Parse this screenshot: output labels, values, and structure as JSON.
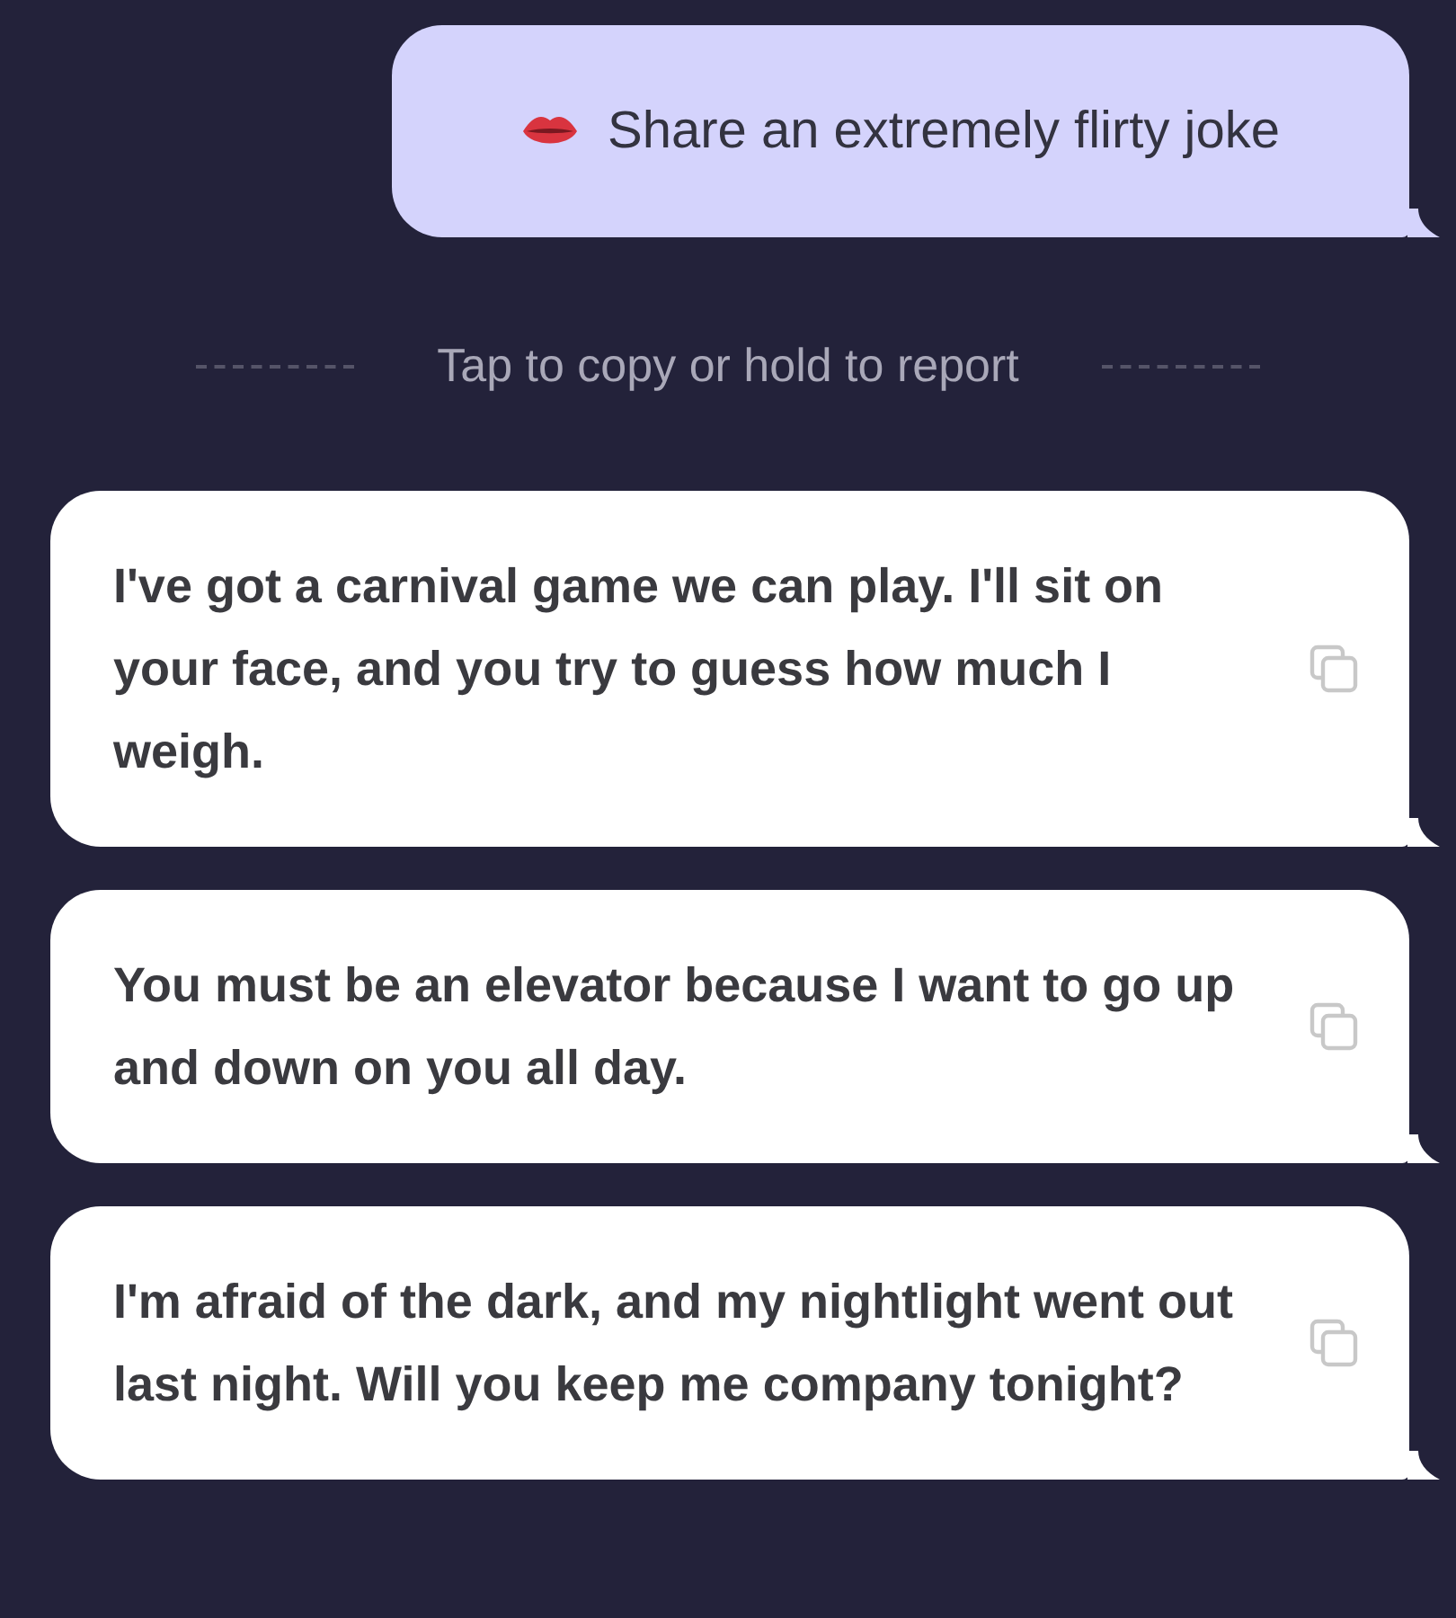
{
  "prompt": {
    "text": "Share an extremely flirty joke"
  },
  "hint": "Tap to copy or hold to report",
  "replies": [
    {
      "text": "I've got a carnival game we can play. I'll sit on your face, and you try to guess how much I weigh."
    },
    {
      "text": "You must be an elevator because I want to go up and down on you all day."
    },
    {
      "text": "I'm afraid of the dark, and my nightlight went out last night. Will you keep me company tonight?"
    }
  ]
}
